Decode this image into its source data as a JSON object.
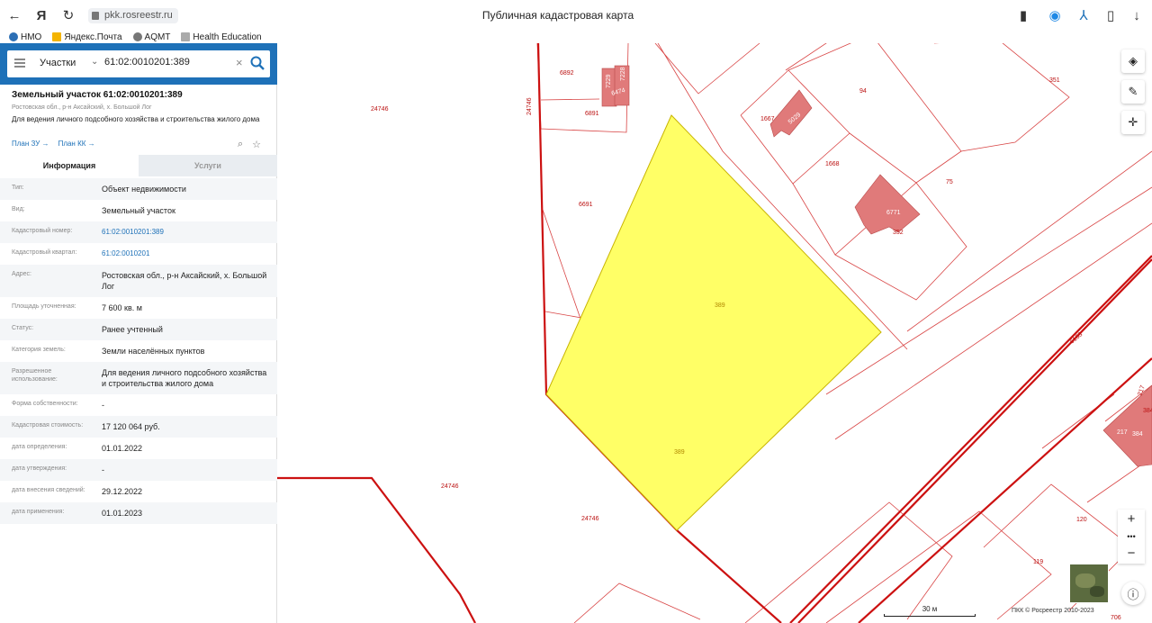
{
  "browser": {
    "url": "pkk.rosreestr.ru",
    "tab_title": "Публичная кадастровая карта",
    "bookmarks": [
      "НМО",
      "Яндекс.Почта",
      "AQMT",
      "Health Education"
    ]
  },
  "search": {
    "type": "Участки",
    "query": "61:02:0010201:389"
  },
  "object": {
    "title": "Земельный участок 61:02:0010201:389",
    "address_short": "Ростовская обл., р-н Аксайский, х. Большой Лог",
    "purpose": "Для ведения личного подсобного хозяйства и строительства жилого дома",
    "link_plan_zu": "План ЗУ →",
    "link_plan_kk": "План КК →"
  },
  "tabs": {
    "info": "Информация",
    "services": "Услуги"
  },
  "fields": [
    {
      "key": "Тип:",
      "value": "Объект недвижимости"
    },
    {
      "key": "Вид:",
      "value": "Земельный участок"
    },
    {
      "key": "Кадастровый номер:",
      "value": "61:02:0010201:389",
      "link": true
    },
    {
      "key": "Кадастровый квартал:",
      "value": "61:02:0010201",
      "link": true
    },
    {
      "key": "Адрес:",
      "value": "Ростовская обл., р-н Аксайский, х. Большой Лог"
    },
    {
      "key": "Площадь уточненная:",
      "value": "7 600 кв. м"
    },
    {
      "key": "Статус:",
      "value": "Ранее учтенный"
    },
    {
      "key": "Категория земель:",
      "value": "Земли населённых пунктов"
    },
    {
      "key": "Разрешенное использование:",
      "value": "Для ведения личного подсобного хозяйства и строительства жилого дома"
    },
    {
      "key": "Форма собственности:",
      "value": "-"
    },
    {
      "key": "Кадастровая стоимость:",
      "value": "17 120 064 руб."
    },
    {
      "key": "дата определения:",
      "value": "01.01.2022"
    },
    {
      "key": "дата утверждения:",
      "value": "-"
    },
    {
      "key": "дата внесения сведений:",
      "value": "29.12.2022"
    },
    {
      "key": "дата применения:",
      "value": "01.01.2023"
    }
  ],
  "map": {
    "labels": [
      "24746",
      "24746",
      "24746",
      "24746",
      "6892",
      "6891",
      "6691",
      "389",
      "389",
      "94",
      "351",
      "1667",
      "5029",
      "1668",
      "75",
      "6771",
      "352",
      "6133",
      "120",
      "119",
      "384",
      "217",
      "217",
      "384",
      "7229",
      "7228",
      "6474",
      "706"
    ],
    "scale": "30 м",
    "copyright": "ПКК © Росреестр 2010-2023"
  },
  "colors": {
    "panel_header": "#1e71b8",
    "parcel_fill": "#ffff66",
    "boundary": "#cc1111",
    "building": "#e07a7a"
  }
}
